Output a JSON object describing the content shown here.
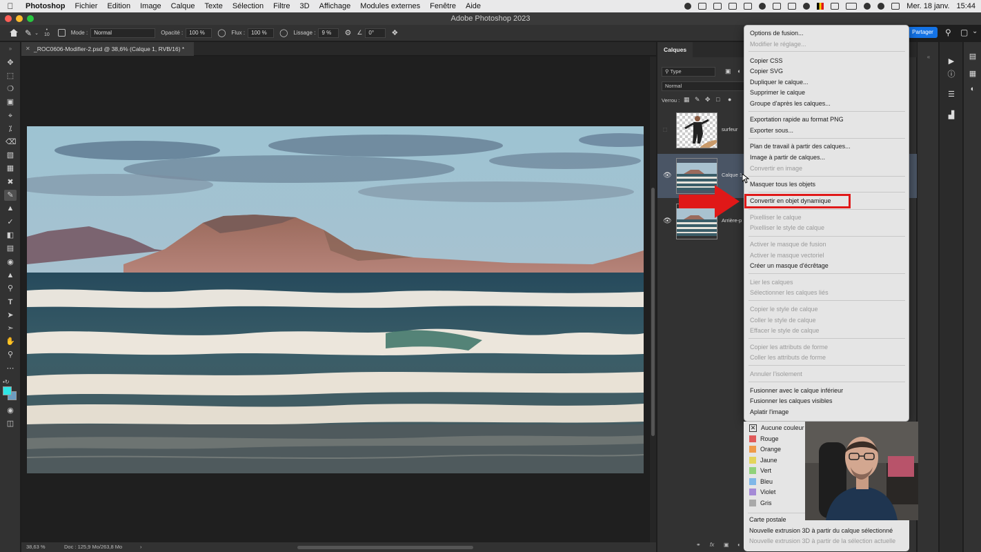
{
  "menubar": {
    "app_name": "Photoshop",
    "menus": [
      "Fichier",
      "Edition",
      "Image",
      "Calque",
      "Texte",
      "Sélection",
      "Filtre",
      "3D",
      "Affichage",
      "Modules externes",
      "Fenêtre",
      "Aide"
    ],
    "datetime": "Mer. 18 janv.",
    "time": "15:44"
  },
  "window": {
    "title": "Adobe Photoshop 2023"
  },
  "optbar": {
    "brush_size": "10",
    "mode_label": "Mode :",
    "mode_value": "Normal",
    "opacity_label": "Opacité :",
    "opacity_value": "100 %",
    "flux_label": "Flux :",
    "flux_value": "100 %",
    "lissage_label": "Lissage :",
    "lissage_value": "9 %",
    "angle_value": "0°",
    "share_label": "Partager"
  },
  "document": {
    "tab_title": "_ROC0606-Modifier-2.psd @ 38,6% (Calque 1, RVB/16) *",
    "zoom": "38,63 %",
    "doc_info": "Doc : 125,9 Mo/263,8 Mo"
  },
  "layers_panel": {
    "title": "Calques",
    "filter": "Type",
    "blend_mode": "Normal",
    "lock_label": "Verrou :",
    "layers": [
      {
        "name": "surfeur",
        "visible": false,
        "selected": false
      },
      {
        "name": "Calque 1",
        "visible": true,
        "selected": true
      },
      {
        "name": "Arrière-p",
        "visible": true,
        "selected": false
      }
    ]
  },
  "context_menu": {
    "highlighted_item": "Convertir en objet dynamique",
    "groups": [
      [
        {
          "label": "Options de fusion...",
          "enabled": true
        },
        {
          "label": "Modifier le réglage...",
          "enabled": false
        }
      ],
      [
        {
          "label": "Copier CSS",
          "enabled": true
        },
        {
          "label": "Copier SVG",
          "enabled": true
        },
        {
          "label": "Dupliquer le calque...",
          "enabled": true
        },
        {
          "label": "Supprimer le calque",
          "enabled": true
        },
        {
          "label": "Groupe d'après les calques...",
          "enabled": true
        }
      ],
      [
        {
          "label": "Exportation rapide au format PNG",
          "enabled": true
        },
        {
          "label": "Exporter sous...",
          "enabled": true
        }
      ],
      [
        {
          "label": "Plan de travail à partir des calques...",
          "enabled": true
        },
        {
          "label": "Image à partir de calques...",
          "enabled": true
        },
        {
          "label": "Convertir en image",
          "enabled": false
        }
      ],
      [
        {
          "label": "Masquer tous les objets",
          "enabled": true
        }
      ],
      [
        {
          "label": "Convertir en objet dynamique",
          "enabled": true
        }
      ],
      [
        {
          "label": "Pixelliser le calque",
          "enabled": false
        },
        {
          "label": "Pixelliser le style de calque",
          "enabled": false
        }
      ],
      [
        {
          "label": "Activer le masque de fusion",
          "enabled": false
        },
        {
          "label": "Activer le masque vectoriel",
          "enabled": false
        },
        {
          "label": "Créer un masque d'écrêtage",
          "enabled": true
        }
      ],
      [
        {
          "label": "Lier les calques",
          "enabled": false
        },
        {
          "label": "Sélectionner les calques liés",
          "enabled": false
        }
      ],
      [
        {
          "label": "Copier le style de calque",
          "enabled": false
        },
        {
          "label": "Coller le style de calque",
          "enabled": false
        },
        {
          "label": "Effacer le style de calque",
          "enabled": false
        }
      ],
      [
        {
          "label": "Copier les attributs de forme",
          "enabled": false
        },
        {
          "label": "Coller les attributs de forme",
          "enabled": false
        }
      ],
      [
        {
          "label": "Annuler l'isolement",
          "enabled": false
        }
      ],
      [
        {
          "label": "Fusionner avec le calque inférieur",
          "enabled": true
        },
        {
          "label": "Fusionner les calques visibles",
          "enabled": true
        },
        {
          "label": "Aplatir l'image",
          "enabled": true
        }
      ]
    ],
    "colors": [
      {
        "label": "Aucune couleur",
        "color": "none"
      },
      {
        "label": "Rouge",
        "color": "#e05a5a"
      },
      {
        "label": "Orange",
        "color": "#ef9a4a"
      },
      {
        "label": "Jaune",
        "color": "#e3d45a"
      },
      {
        "label": "Vert",
        "color": "#8fd17a"
      },
      {
        "label": "Bleu",
        "color": "#7fb7e8"
      },
      {
        "label": "Violet",
        "color": "#a48ad6"
      },
      {
        "label": "Gris",
        "color": "#a9a9a9"
      }
    ],
    "bottom": [
      {
        "label": "Carte postale",
        "enabled": true
      },
      {
        "label": "Nouvelle extrusion 3D à partir du calque sélectionné",
        "enabled": true
      },
      {
        "label": "Nouvelle extrusion 3D à partir de la sélection actuelle",
        "enabled": false
      }
    ]
  },
  "icons": {
    "tools": [
      "move-icon",
      "marquee-icon",
      "lasso-icon",
      "object-select-icon",
      "crop-icon",
      "eyedropper-icon",
      "healing-icon",
      "brush-icon",
      "stamp-icon",
      "history-brush-icon",
      "eraser-icon",
      "gradient-icon",
      "blur-icon",
      "dodge-icon",
      "pen-icon",
      "type-icon",
      "path-select-icon",
      "hand-icon",
      "zoom-icon",
      "more-icon"
    ],
    "accent": "#1473e6",
    "highlight": "#e01818"
  }
}
